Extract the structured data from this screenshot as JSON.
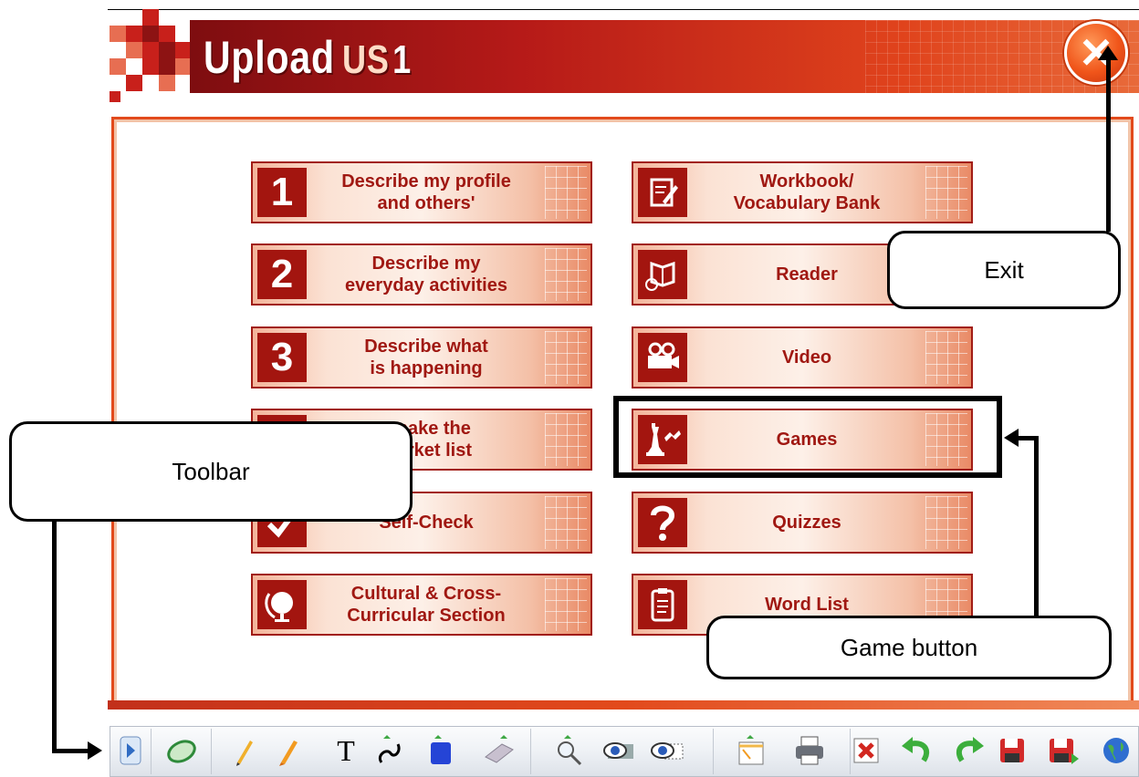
{
  "app": {
    "logo": {
      "word1": "Upload",
      "word2": "US",
      "word3": "1"
    },
    "exit_glyph": "✕"
  },
  "menu": {
    "left": [
      {
        "number": "1",
        "label": "Describe my profile\nand others'"
      },
      {
        "number": "2",
        "label": "Describe my\neveryday activities"
      },
      {
        "number": "3",
        "label": "Describe what\nis happening"
      },
      {
        "number": "4",
        "label": "I make the\nmarket list"
      },
      {
        "icon": "checkmark-icon",
        "label": "Self-Check"
      },
      {
        "icon": "globe-icon",
        "label": "Cultural & Cross-\nCurricular Section"
      }
    ],
    "right": [
      {
        "icon": "workbook-icon",
        "label": "Workbook/\nVocabulary Bank"
      },
      {
        "icon": "reader-icon",
        "label": "Reader"
      },
      {
        "icon": "video-camera-icon",
        "label": "Video"
      },
      {
        "icon": "chess-piece-icon",
        "label": "Games"
      },
      {
        "icon": "question-mark-icon",
        "label": "Quizzes"
      },
      {
        "icon": "clipboard-icon",
        "label": "Word List"
      }
    ]
  },
  "callouts": {
    "exit": "Exit",
    "toolbar": "Toolbar",
    "games": "Game button"
  },
  "toolbar": {
    "text_tool_glyph": "T",
    "items": [
      "expand-arrow-icon",
      "mouse-icon",
      "pencil-icon",
      "highlighter-icon",
      "text-icon",
      "freehand-line-icon",
      "shape-icon",
      "eraser-icon",
      "magnifier-icon",
      "spotlight-icon",
      "reveal-icon",
      "blank-page-icon",
      "print-icon",
      "clear-icon",
      "undo-icon",
      "redo-icon",
      "save-icon",
      "save-as-icon",
      "globe-web-icon"
    ]
  }
}
